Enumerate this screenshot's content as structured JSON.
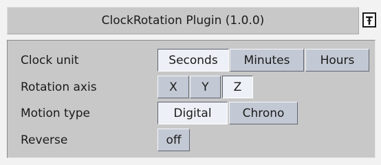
{
  "plugin": {
    "title": "ClockRotation Plugin (1.0.0)",
    "icon": "plugin-tool-icon"
  },
  "settings": {
    "clock_unit": {
      "label": "Clock unit",
      "options": [
        "Seconds",
        "Minutes",
        "Hours"
      ],
      "selected": "Seconds"
    },
    "rotation_axis": {
      "label": "Rotation axis",
      "options": [
        "X",
        "Y",
        "Z"
      ],
      "selected": "Z"
    },
    "motion_type": {
      "label": "Motion type",
      "options": [
        "Digital",
        "Chrono"
      ],
      "selected": "Digital"
    },
    "reverse": {
      "label": "Reverse",
      "value": "off"
    }
  }
}
